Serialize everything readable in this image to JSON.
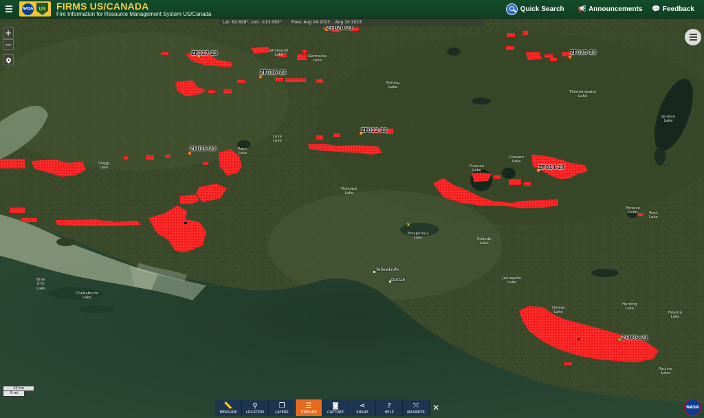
{
  "header": {
    "menu_icon": "hamburger-menu-icon",
    "logo_nasa": "NASA",
    "logo_usfs": "US",
    "title": "FIRMS US/CANADA",
    "subtitle": "Fire Information for Resource Management System US/Canada",
    "quick_search_label": "Quick Search",
    "announcements_label": "Announcements",
    "feedback_label": "Feedback"
  },
  "coordinates": {
    "position": "Lat: 62.828°, Lon: -113.093°",
    "fires_range": "Fires: Aug 04 2023 .. Aug 10 2023"
  },
  "map_controls": {
    "zoom_in": "+",
    "zoom_out": "−"
  },
  "fire_labels": [
    "ZF017-23",
    "ZF016-23",
    "ZF025-23",
    "ZF012-23",
    "ZF015-23",
    "ZF014-23",
    "ZF085-23",
    "ZF020-23"
  ],
  "places": {
    "whitewolf": "Whitewolf\nLake",
    "germaine": "Germaine\nLake",
    "fishing": "Fishing\nLake",
    "thistlethwaite": "Thistlethwaite\nLake",
    "gordon": "Gordon\nLake",
    "love": "Love\nLake",
    "awry": "Awry\nLake",
    "stagg": "Stagg\nLake",
    "duncan": "Duncan\nLake",
    "graham": "Graham\nLake",
    "fishback": "Fishback\nLake",
    "prosperous": "Prosperous\nLake",
    "prelude": "Prelude\nLake",
    "pensive": "Pensive\nLake",
    "ross": "Ross\nLake",
    "bras_dor": "Bras\nd'Or\nLake",
    "chedabucto": "Chedabucto\nLake",
    "jennejohn": "Jennejohn\nLake",
    "harding": "Harding\nLake",
    "hearne": "Hearne\nLake",
    "defeat": "Defeat\nLake",
    "pauline": "Pauline\nLake"
  },
  "towns": {
    "yellowknife": "Yellowknife",
    "dettah": "Dettah"
  },
  "scale": {
    "km": "10 km",
    "mi": "5 mi"
  },
  "toolbar": {
    "measure": "MEASURE",
    "location": "LOCATION",
    "layers": "LAYERS",
    "timeline": "TIMELINE",
    "capture": "CAPTURE",
    "share": "SHARE",
    "help": "HELP",
    "maximize": "MAXIMIZE",
    "close": "✕"
  },
  "nasa_corner": "NASA",
  "colors": {
    "header_bg": "#134d2a",
    "title_yellow": "#f4d03f",
    "fire_red": "#ff2a2a",
    "toolbar_bg": "#1e3550",
    "toolbar_active": "#e86a1e"
  }
}
